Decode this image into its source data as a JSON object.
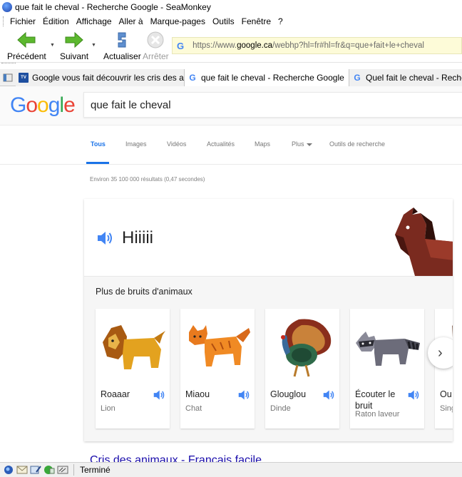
{
  "window": {
    "title": "que fait le cheval - Recherche Google - SeaMonkey"
  },
  "menubar": {
    "items": [
      {
        "label": "Fichier"
      },
      {
        "label": "Édition"
      },
      {
        "label": "Affichage"
      },
      {
        "label": "Aller à"
      },
      {
        "label": "Marque-pages"
      },
      {
        "label": "Outils"
      },
      {
        "label": "Fenêtre"
      },
      {
        "label": "?"
      }
    ]
  },
  "toolbar": {
    "back_label": "Précédent",
    "forward_label": "Suivant",
    "reload_label": "Actualiser",
    "stop_label": "Arrêter",
    "url_prefix": "https://www.",
    "url_domain": "google.ca",
    "url_rest": "/webhp?hl=fr#hl=fr&q=que+fait+le+cheval"
  },
  "tabs": [
    {
      "label": "Google vous fait découvrir les cris des an...",
      "favicon": "fr-tv-icon"
    },
    {
      "label": "que fait le cheval - Recherche Google",
      "favicon": "google-icon"
    },
    {
      "label": "Quel fait le cheval - Recherche",
      "favicon": "google-icon"
    }
  ],
  "google": {
    "logo_letters": [
      "G",
      "o",
      "o",
      "g",
      "l",
      "e"
    ],
    "query": "que fait le cheval",
    "nav_tabs": [
      {
        "label": "Tous",
        "active": true
      },
      {
        "label": "Images"
      },
      {
        "label": "Vidéos"
      },
      {
        "label": "Actualités"
      },
      {
        "label": "Maps"
      },
      {
        "label": "Plus"
      },
      {
        "label": "Outils de recherche"
      }
    ],
    "stats": "Environ 35 100 000 résultats (0,47 secondes)",
    "answer": {
      "sound": "Hiiiii",
      "more_title": "Plus de bruits d'animaux",
      "animals": [
        {
          "sound": "Roaaar",
          "name": "Lion",
          "icon": "lion-illustration"
        },
        {
          "sound": "Miaou",
          "name": "Chat",
          "icon": "cat-illustration"
        },
        {
          "sound": "Glouglou",
          "name": "Dinde",
          "icon": "turkey-illustration"
        },
        {
          "sound": "Écouter le bruit",
          "name": "Raton laveur",
          "icon": "raccoon-illustration"
        },
        {
          "sound": "Ou ah",
          "name": "Sing",
          "icon": "monkey-illustration"
        }
      ]
    },
    "first_result": "Cris des animaux - Français facile"
  },
  "statusbar": {
    "text": "Terminé"
  },
  "colors": {
    "google_blue": "#4285f4",
    "link": "#1a0dab",
    "url_bar_bg": "#fdfbd8"
  }
}
